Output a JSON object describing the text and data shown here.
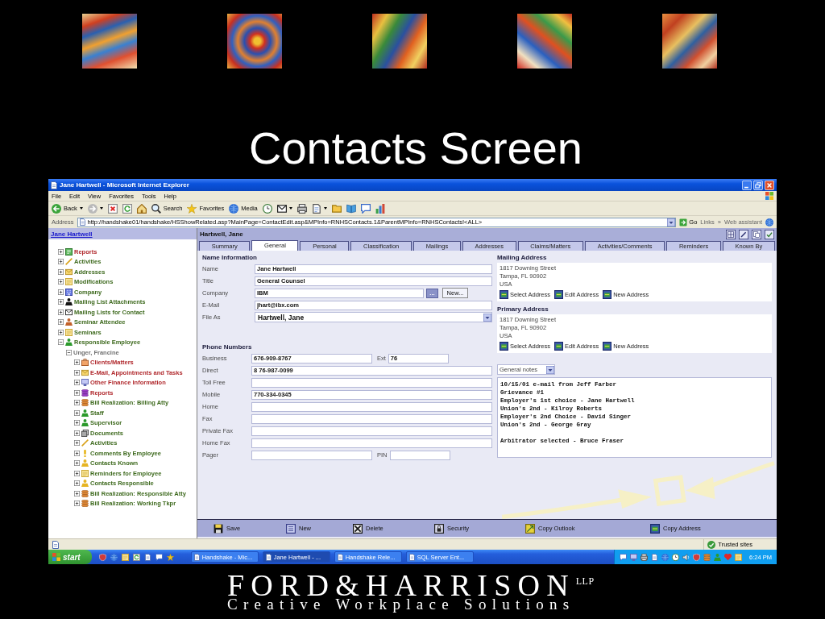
{
  "header_images": [
    {
      "kind": "painting"
    },
    {
      "kind": "painting"
    },
    {
      "kind": "painting"
    },
    {
      "kind": "painting"
    },
    {
      "kind": "painting"
    }
  ],
  "slide_title": "Contacts Screen",
  "browser": {
    "title": "Jane Hartwell - Microsoft Internet Explorer",
    "menu": [
      "File",
      "Edit",
      "View",
      "Favorites",
      "Tools",
      "Help"
    ],
    "toolbar": [
      {
        "kind": "back",
        "label": "Back",
        "dropdown": true
      },
      {
        "kind": "forward",
        "dropdown": true
      },
      {
        "kind": "stop",
        "dropdown": false
      },
      {
        "kind": "refresh",
        "dropdown": false
      },
      {
        "kind": "home",
        "dropdown": false
      },
      {
        "kind": "search",
        "label": "Search",
        "dropdown": false
      },
      {
        "kind": "favorites",
        "label": "Favorites",
        "dropdown": false
      },
      {
        "kind": "media",
        "label": "Media",
        "dropdown": false
      },
      {
        "kind": "history",
        "dropdown": false
      },
      {
        "kind": "mail",
        "dropdown": true
      },
      {
        "kind": "print",
        "dropdown": false
      },
      {
        "kind": "edit",
        "dropdown": true
      },
      {
        "kind": "folder",
        "dropdown": false
      },
      {
        "kind": "research",
        "dropdown": false
      },
      {
        "kind": "chat",
        "dropdown": false
      },
      {
        "kind": "chart",
        "dropdown": false
      }
    ],
    "address": {
      "label": "Address",
      "url": "http://handshake01/handshake/HSShowRelated.asp?MainPage=ContactEdit.asp&MPInfo=RNHSContacts.1&ParentMPInfo=RNHSContacts!<ALL>",
      "go": "Go",
      "links": "Links",
      "more": "»",
      "assistant": "Web assistant"
    }
  },
  "app": {
    "sidebar": {
      "title": "Jane Hartwell",
      "tree": [
        {
          "label": "Reports",
          "kind": "sheet",
          "color": "#b0282c",
          "expanded": false
        },
        {
          "label": "Activities",
          "kind": "pencil",
          "color": "#3e6a1e",
          "expanded": false
        },
        {
          "label": "Addresses",
          "kind": "envelope",
          "color": "#3e6a1e",
          "expanded": false
        },
        {
          "label": "Modifications",
          "kind": "note",
          "color": "#3e6a1e",
          "expanded": false
        },
        {
          "label": "Company",
          "kind": "building",
          "color": "#3e6a1e",
          "expanded": false
        },
        {
          "label": "Mailing List Attachments",
          "kind": "member",
          "color": "#3e6a1e",
          "expanded": false
        },
        {
          "label": "Mailing Lists for Contact",
          "kind": "mail",
          "color": "#3e6a1e",
          "expanded": false
        },
        {
          "label": "Seminar Attendee",
          "kind": "attendee",
          "color": "#3e6a1e",
          "expanded": false
        },
        {
          "label": "Seminars",
          "kind": "note",
          "color": "#3e6a1e",
          "expanded": false
        },
        {
          "label": "Responsible Employee",
          "kind": "person",
          "color": "#3e6a1e",
          "expanded": true,
          "children": [
            {
              "label": "Unger, Francine",
              "color": "#707070",
              "expanded": true,
              "children": [
                {
                  "label": "Clients/Matters",
                  "kind": "case",
                  "color": "#b0282c",
                  "expanded": false
                },
                {
                  "label": "E-Mail, Appointments and Tasks",
                  "kind": "envelope",
                  "color": "#b0282c",
                  "expanded": false
                },
                {
                  "label": "Other Finance Information",
                  "kind": "screen",
                  "color": "#b0282c",
                  "expanded": false
                },
                {
                  "label": "Reports",
                  "kind": "coins2",
                  "color": "#b0282c",
                  "expanded": false
                },
                {
                  "label": "Bill Realization: Billing Atty",
                  "kind": "coins",
                  "color": "#3e6a1e",
                  "expanded": false
                },
                {
                  "label": "Staff",
                  "kind": "person",
                  "color": "#3e6a1e",
                  "expanded": false
                },
                {
                  "label": "Supervisor",
                  "kind": "person",
                  "color": "#3e6a1e",
                  "expanded": false
                },
                {
                  "label": "Documents",
                  "kind": "pages",
                  "color": "#3e6a1e",
                  "expanded": false
                },
                {
                  "label": "Activities",
                  "kind": "pencil",
                  "color": "#3e6a1e",
                  "expanded": false
                },
                {
                  "label": "Comments By Employee",
                  "kind": "alert",
                  "color": "#3e6a1e",
                  "expanded": false
                },
                {
                  "label": "Contacts Known",
                  "kind": "contact",
                  "color": "#3e6a1e",
                  "expanded": false
                },
                {
                  "label": "Reminders for Employee",
                  "kind": "note",
                  "color": "#3e6a1e",
                  "expanded": false
                },
                {
                  "label": "Contacts Responsible",
                  "kind": "contact",
                  "color": "#3e6a1e",
                  "expanded": false
                },
                {
                  "label": "Bill Realization: Responsible Atty",
                  "kind": "coins",
                  "color": "#3e6a1e",
                  "expanded": false
                },
                {
                  "label": "Bill Realization: Working Tkpr",
                  "kind": "coins",
                  "color": "#3e6a1e",
                  "expanded": false
                }
              ]
            }
          ]
        }
      ]
    },
    "record_title": "Hartwell, Jane",
    "record_tools": [
      {
        "kind": "grid"
      },
      {
        "kind": "edit"
      },
      {
        "kind": "copy"
      },
      {
        "kind": "check"
      }
    ],
    "tabs": [
      {
        "label": "Summary",
        "selected": false
      },
      {
        "label": "General",
        "selected": true
      },
      {
        "label": "Personal",
        "selected": false
      },
      {
        "label": "Classification",
        "selected": false
      },
      {
        "label": "Mailings",
        "selected": false
      },
      {
        "label": "Addresses",
        "selected": false
      },
      {
        "label": "Claims/Matters",
        "selected": false
      },
      {
        "label": "Activities/Comments",
        "selected": false
      },
      {
        "label": "Reminders",
        "selected": false
      },
      {
        "label": "Known By",
        "selected": false
      }
    ],
    "name_section": {
      "heading": "Name Information",
      "fields": [
        {
          "kind": "text",
          "label": "Name",
          "value": "Jane Hartwell"
        },
        {
          "kind": "text",
          "label": "Title",
          "value": "General Counsel"
        },
        {
          "kind": "lookup",
          "label": "Company",
          "value": "IBM",
          "browse": "...",
          "new_button": "New..."
        },
        {
          "kind": "text",
          "label": "E-Mail",
          "value": "jhart@ibx.com"
        },
        {
          "kind": "select",
          "label": "File As",
          "value": "Hartwell, Jane"
        }
      ]
    },
    "phone_section": {
      "heading": "Phone Numbers",
      "fields": [
        {
          "kind": "split",
          "label": "Business",
          "value": "676-909-8767",
          "extra_label": "Ext",
          "extra_value": "76"
        },
        {
          "kind": "text",
          "label": "Direct",
          "value": "8 76-987-0099"
        },
        {
          "kind": "text",
          "label": "Toll Free"
        },
        {
          "kind": "text",
          "label": "Mobile",
          "value": "770-334-0345"
        },
        {
          "kind": "text",
          "label": "Home"
        },
        {
          "kind": "text",
          "label": "Fax"
        },
        {
          "kind": "text",
          "label": "Private Fax"
        },
        {
          "kind": "text",
          "label": "Home Fax"
        },
        {
          "kind": "split",
          "label": "Pager",
          "extra_label": "PIN"
        }
      ]
    },
    "addresses": [
      {
        "heading": "Mailing Address",
        "lines": [
          "1817 Downing Street",
          "Tampa, FL 90902",
          "USA"
        ],
        "actions": [
          "Select Address",
          "Edit Address",
          "New Address"
        ]
      },
      {
        "heading": "Primary Address",
        "lines": [
          "1817 Downing Street",
          "Tampa, FL 90902",
          "USA"
        ],
        "actions": [
          "Select Address",
          "Edit Address",
          "New Address"
        ]
      }
    ],
    "notes": {
      "category": "General notes",
      "text": "10/15/01 e-mail from Jeff Farber\nGrievance #1\nEmployer's 1st choice - Jane Hartwell\nUnion's 2nd - Kilroy Roberts\nEmployer's 2nd Choice - David Singer\nUnion's 2nd - George Gray\n\nArbitrator selected - Bruce Fraser"
    },
    "actions": [
      {
        "kind": "save",
        "label": "Save"
      },
      {
        "kind": "new",
        "label": "New"
      },
      {
        "kind": "delete",
        "label": "Delete"
      },
      {
        "kind": "security",
        "label": "Security"
      },
      {
        "kind": "outlook",
        "label": "Copy Outlook"
      },
      {
        "kind": "address",
        "label": "Copy Address"
      }
    ],
    "backdrop": {
      "kind": "arrows"
    }
  },
  "status_bar": {
    "zone": "Trusted sites"
  },
  "taskbar": {
    "start": "start",
    "quick_launch": [
      {
        "kind": "shield"
      },
      {
        "kind": "media"
      },
      {
        "kind": "note"
      },
      {
        "kind": "refresh"
      },
      {
        "kind": "page"
      },
      {
        "kind": "chat"
      },
      {
        "kind": "favorites"
      }
    ],
    "tasks": [
      {
        "label": "Handshake - Mic...",
        "selected": false
      },
      {
        "label": "Jane Hartwell - ...",
        "selected": true
      },
      {
        "label": "Handshake Rele...",
        "selected": false
      },
      {
        "label": "SQL Server Ent...",
        "selected": false
      }
    ],
    "tray": [
      {
        "kind": "chat"
      },
      {
        "kind": "screen"
      },
      {
        "kind": "print"
      },
      {
        "kind": "page"
      },
      {
        "kind": "media"
      },
      {
        "kind": "history"
      },
      {
        "kind": "speaker"
      },
      {
        "kind": "shield"
      },
      {
        "kind": "coins"
      },
      {
        "kind": "person"
      },
      {
        "kind": "heart"
      },
      {
        "kind": "note"
      }
    ],
    "clock": "6:24 PM"
  },
  "footer": {
    "logo": "FORD&HARRISON$^{LLP}$",
    "tagline": "Creative Workplace Solutions"
  }
}
